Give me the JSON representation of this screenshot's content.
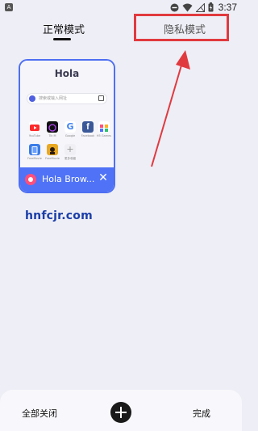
{
  "status_bar": {
    "app_badge": "A",
    "time": "3:37",
    "icons": [
      "minus-circle-icon",
      "wifi-icon",
      "signal-off-icon",
      "battery-icon"
    ]
  },
  "tabs": {
    "normal_label": "正常模式",
    "private_label": "隐私模式"
  },
  "tab_card": {
    "logo": "Hola",
    "search_placeholder": "搜索或输入网址",
    "shortcuts": [
      {
        "label": "YouTube",
        "icon": "youtube-icon",
        "color": "#ff2a2a"
      },
      {
        "label": "Tik M",
        "icon": "tiktok-icon",
        "color": "#111111"
      },
      {
        "label": "Google",
        "icon": "google-icon",
        "color": "#4285f4"
      },
      {
        "label": "Facebook",
        "icon": "facebook-icon",
        "color": "#3b5998"
      },
      {
        "label": "H5 Games",
        "icon": "games-icon",
        "color": "#ffffff"
      },
      {
        "label": "FreeMovie",
        "icon": "tablet-icon",
        "color": "#3a7ce8"
      },
      {
        "label": "FreeMovie",
        "icon": "movie-icon",
        "color": "#e8a822"
      },
      {
        "label": "更多收藏",
        "icon": "plus-icon",
        "color": "#f0f0f4"
      }
    ],
    "footer_title": "Hola Brow...",
    "accent_color": "#4f72f6"
  },
  "watermark": "hnfcjr.com",
  "bottom_bar": {
    "close_all": "全部关闭",
    "done": "完成"
  }
}
